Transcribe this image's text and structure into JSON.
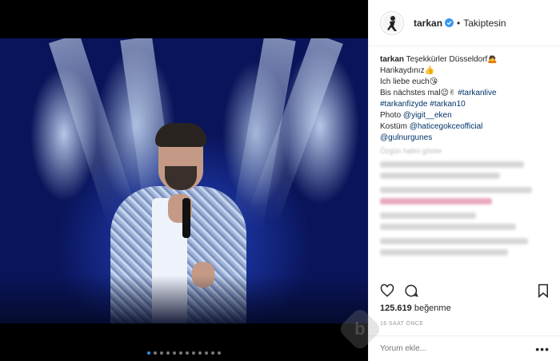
{
  "post": {
    "username": "tarkan",
    "separator": "•",
    "follow_status": "Takiptesin"
  },
  "caption": {
    "author": "tarkan",
    "lines": [
      "Teşekkürler Düsseldorf🙇",
      "Harikaydınız👍",
      "Ich liebe euch😘",
      "Bis nächstes mal😉✌"
    ],
    "hashtag1": "#tarkanlive",
    "hashtag2": "#tarkanfizyde",
    "hashtag3": "#tarkan10",
    "photo_prefix": "Photo ",
    "photo_mention": "@yigit__eken",
    "costume_prefix": "Kostüm ",
    "costume_mention": "@haticegokceofficial",
    "extra_mention": "@gulnurgunes",
    "translate_link": "Özgün halini göster"
  },
  "stats": {
    "likes_count": "125.619",
    "likes_label": "beğenme",
    "time_ago": "16 SAAT ÖNCE"
  },
  "comment": {
    "placeholder": "Yorum ekle..."
  },
  "icons": {
    "like": "heart-icon",
    "comment": "comment-icon",
    "save": "bookmark-icon",
    "more": "more-options-icon",
    "verified": "verified-badge-icon"
  },
  "carousel": {
    "total": 12,
    "active_index": 0
  },
  "colors": {
    "link": "#003569",
    "verified": "#3897f0",
    "active_dot": "#2a8cf0"
  },
  "more_label": "•••",
  "watermark_letter": "b"
}
